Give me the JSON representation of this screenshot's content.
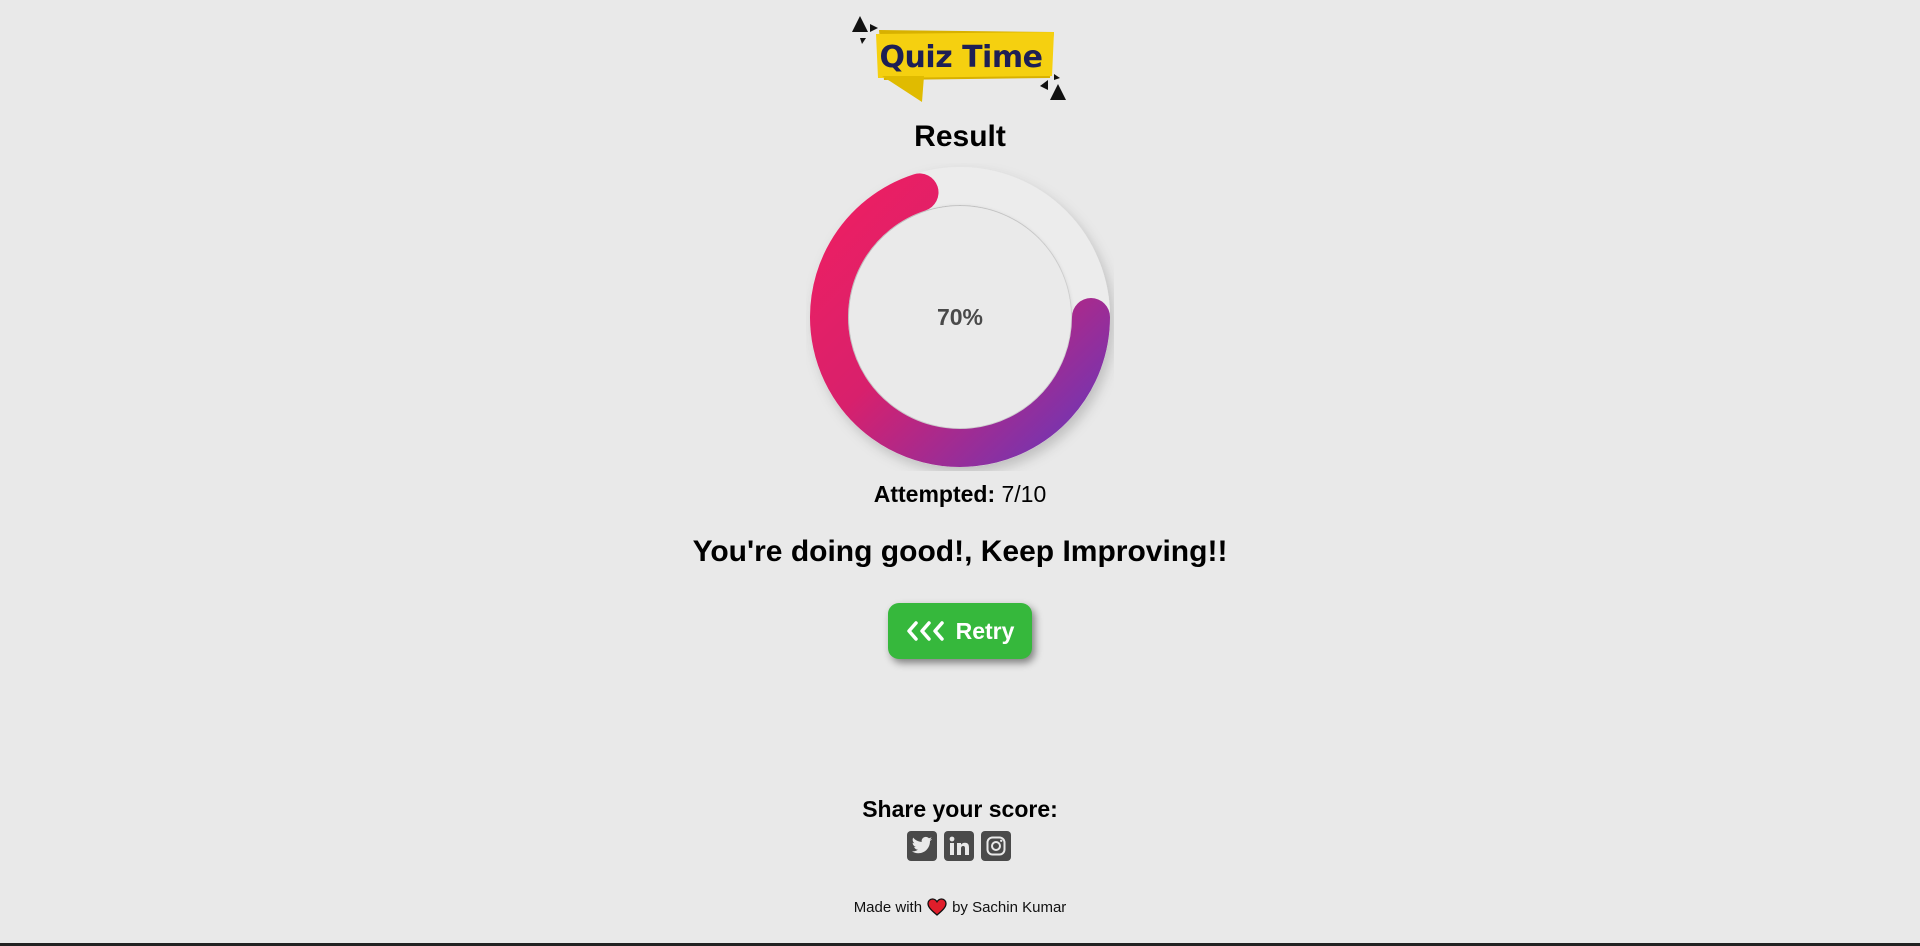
{
  "logo": {
    "text": "Quiz Time",
    "color_bg": "#f5d010",
    "color_text": "#1d1f55"
  },
  "result": {
    "title": "Result",
    "percent": 70,
    "percent_label": "70%",
    "gradient_start": "#ee1f62",
    "gradient_end": "#6a37b8"
  },
  "attempted": {
    "label": "Attempted:",
    "value": "7/10"
  },
  "message": "You're doing good!, Keep Improving!!",
  "retry": {
    "icon": "chevrons-left-icon",
    "label": "Retry",
    "color": "#36b83c"
  },
  "share": {
    "label": "Share your score:",
    "icons": [
      "twitter-icon",
      "linkedin-icon",
      "instagram-icon"
    ]
  },
  "footer": {
    "prefix": "Made with",
    "icon": "heart-icon",
    "suffix": "by Sachin Kumar"
  }
}
